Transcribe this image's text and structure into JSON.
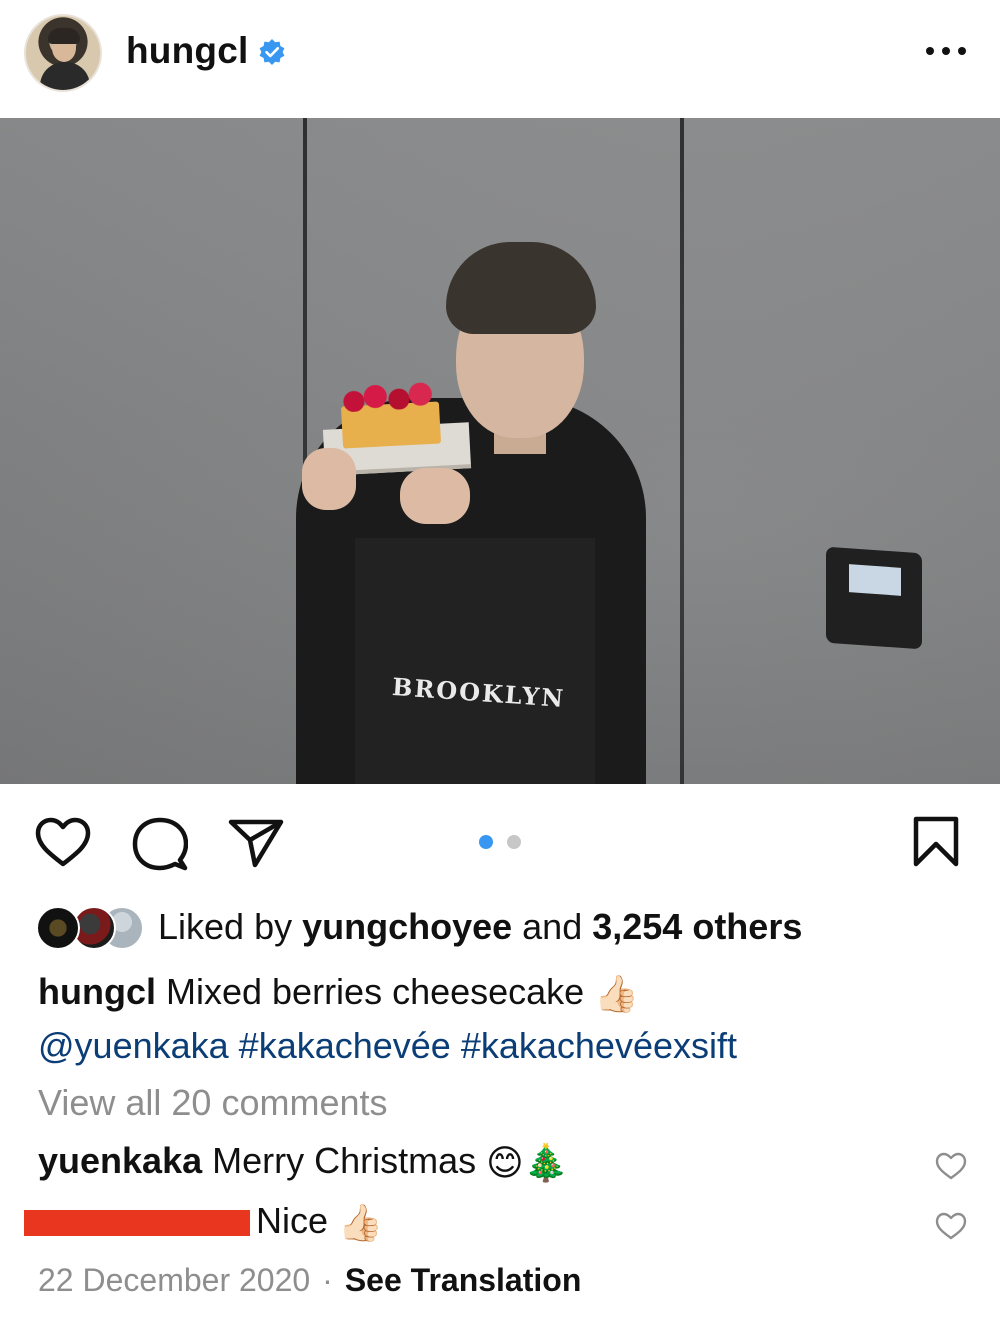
{
  "post": {
    "username": "hungcl",
    "verified": true,
    "image_count": 2,
    "active_image_index": 0
  },
  "photo": {
    "hoodie_text": "BROOKLYN"
  },
  "likes": {
    "prefix": "Liked by ",
    "liker": "yungchoyee",
    "middle": " and ",
    "others": "3,254 others"
  },
  "caption": {
    "username": "hungcl",
    "text": "Mixed berries cheesecake",
    "emoji": "👍🏻",
    "mention": "@yuenkaka",
    "hashtag1": "#kakachevée",
    "hashtag2": "#kakachevéexsift"
  },
  "view_all": "View all 20 comments",
  "comments": [
    {
      "username": "yuenkaka",
      "text": "Merry Christmas",
      "emoji1": "😊",
      "emoji2": "🎄"
    },
    {
      "username": "[redacted]",
      "text": "Nice",
      "emoji1": "👍🏻"
    }
  ],
  "footer": {
    "date": "22 December 2020",
    "separator": "·",
    "see_translation": "See Translation"
  },
  "icons": {
    "header": [
      "verified-badge-icon",
      "more-options-icon"
    ],
    "actions": [
      "heart-icon",
      "comment-icon",
      "share-icon",
      "save-icon"
    ]
  },
  "colors": {
    "accent_blue": "#3897f0",
    "link_blue": "#0b3d76",
    "muted_gray": "#8e8e8e",
    "redaction": "#e8361f"
  }
}
